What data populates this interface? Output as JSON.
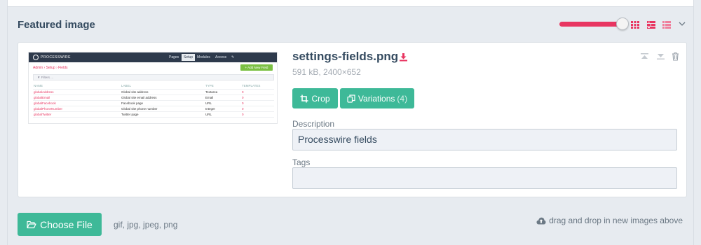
{
  "header": {
    "title": "Featured image",
    "size_slider": {
      "value_fraction": 1.0,
      "color": "#e83561"
    },
    "view_icons": [
      "grid-icon",
      "list-icon",
      "detail-list-icon",
      "chevron-down-icon"
    ]
  },
  "image": {
    "filename": "settings-fields.png",
    "meta": "591 kB, 2400×652",
    "crop_label": "Crop",
    "variations_label": "Variations",
    "variations_count": "(4)",
    "description_label": "Description",
    "description_value": "Processwire fields",
    "tags_label": "Tags",
    "tags_value": ""
  },
  "thumbnail": {
    "brand": "PROCESSWIRE",
    "nav": [
      "Pages",
      "Setup",
      "Modules",
      "Access"
    ],
    "breadcrumb": "Admin › Setup › Fields",
    "add_button": "+ Add New Field",
    "filter": "▼ Filters ...",
    "columns": [
      "NAME",
      "LABEL",
      "TYPE",
      "TEMPLATES"
    ],
    "rows": [
      [
        "globalAddress",
        "Global site address",
        "Textarea",
        "0"
      ],
      [
        "globalEmail",
        "Global site email address",
        "Email",
        "0"
      ],
      [
        "globalFacebook",
        "Facebook page",
        "URL",
        "0"
      ],
      [
        "globalPhoneNumber",
        "Global site phone number",
        "Integer",
        "0"
      ],
      [
        "globalTwitter",
        "Twitter page",
        "URL",
        "0"
      ]
    ]
  },
  "footer": {
    "choose_label": "Choose File",
    "formats": "gif, jpg, jpeg, png",
    "dnd_text": "drag and drop in new images above"
  },
  "colors": {
    "accent": "#e83561",
    "button": "#3eb998",
    "text": "#354b60"
  }
}
